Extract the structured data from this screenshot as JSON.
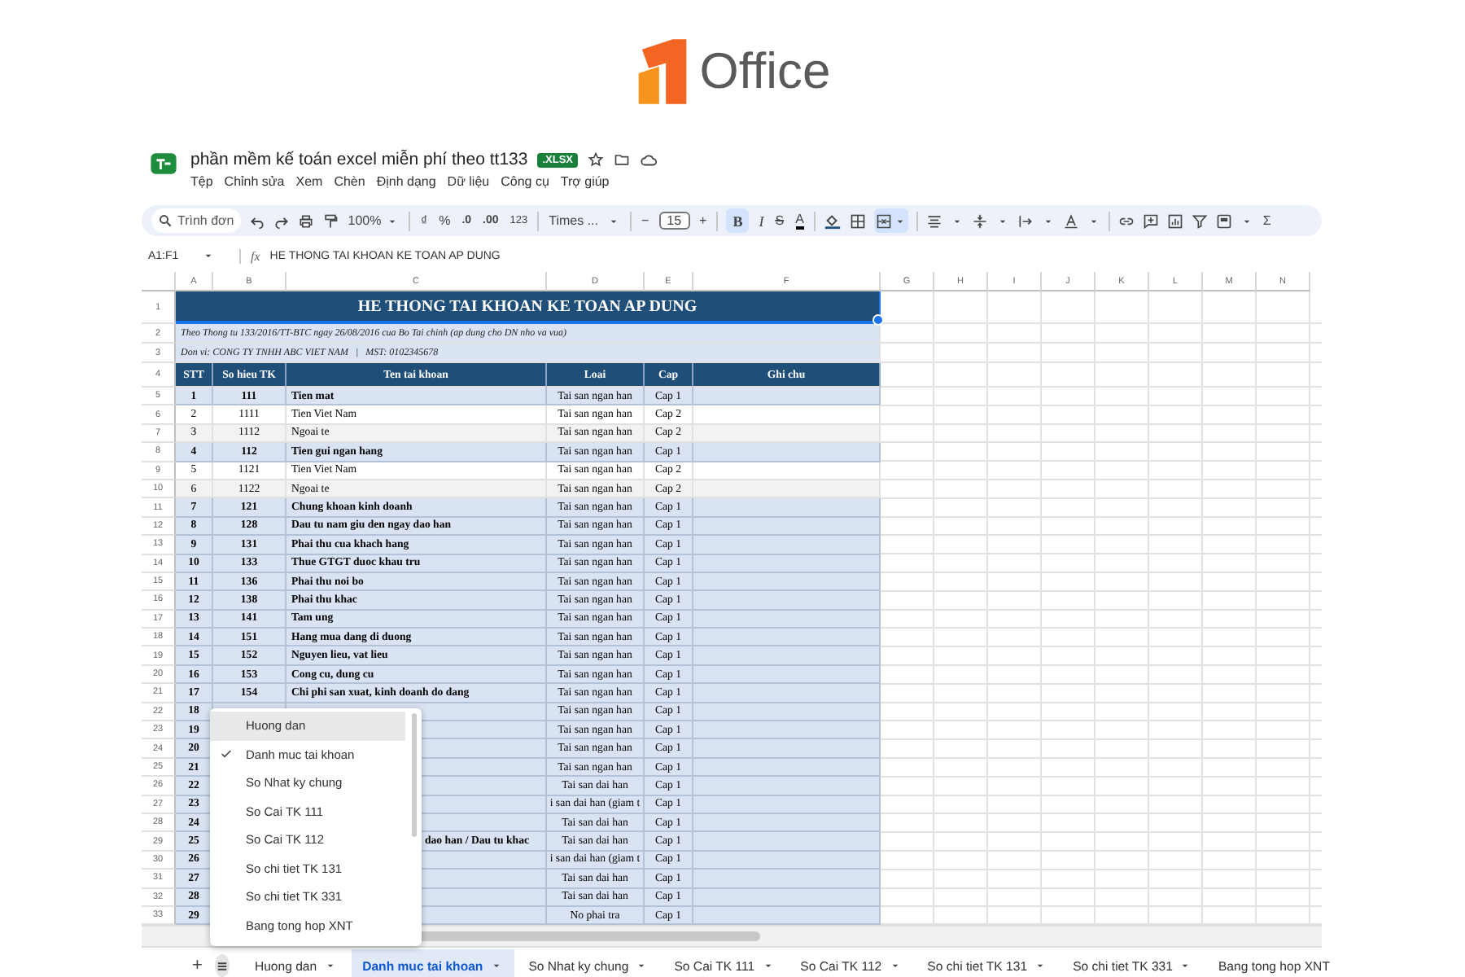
{
  "logo": {
    "text": "Office"
  },
  "document": {
    "title": "phần mềm kế toán excel miễn phí theo tt133",
    "badge": ".XLSX"
  },
  "menu": [
    "Tệp",
    "Chỉnh sửa",
    "Xem",
    "Chèn",
    "Định dạng",
    "Dữ liệu",
    "Công cụ",
    "Trợ giúp"
  ],
  "toolbar": {
    "search_placeholder": "Trình đơn",
    "zoom": "100%",
    "currency": "₫",
    "percent": "%",
    "decrease_decimal": ".0",
    "increase_decimal": ".00",
    "number_format": "123",
    "font": "Times ...",
    "minus": "−",
    "font_size": "15",
    "plus": "+",
    "bold": {
      "label": "B",
      "on": true
    },
    "italic": "I",
    "strike": "S",
    "text_color": "A",
    "sum": "Σ"
  },
  "formula_bar": {
    "range": "A1:F1",
    "fx": "fx",
    "content": "HE THONG TAI KHOAN KE TOAN AP DUNG"
  },
  "column_headers": [
    "A",
    "B",
    "C",
    "D",
    "E",
    "F",
    "G",
    "H",
    "I",
    "J",
    "K",
    "L",
    "M",
    "N"
  ],
  "row_headers": [
    "1",
    "2",
    "3",
    "4",
    "5",
    "6",
    "7",
    "8",
    "9",
    "10",
    "11",
    "12",
    "13",
    "14",
    "15",
    "16",
    "17",
    "18",
    "19",
    "20",
    "21",
    "22",
    "23",
    "24",
    "25",
    "26",
    "27",
    "28",
    "29",
    "30",
    "31",
    "32",
    "33"
  ],
  "sheet": {
    "title": "HE THONG TAI KHOAN KE TOAN AP DUNG",
    "title_selected": true,
    "subtitle": "Theo Thong tu 133/2016/TT-BTC ngay 26/08/2016 cua Bo Tai chinh (ap dung cho DN nho va vua)",
    "company": "Don vi: CONG TY TNHH ABC VIET NAM   |   MST: 0102345678",
    "columns": [
      "STT",
      "So hieu TK",
      "Ten tai khoan",
      "Loai",
      "Cap",
      "Ghi chu"
    ],
    "rows": [
      {
        "kind": "account",
        "stt": "1",
        "code": "111",
        "name": "Tien mat",
        "type": "Tai san ngan han",
        "cap": "Cap 1"
      },
      {
        "kind": "sub_account",
        "stt": "2",
        "code": "1111",
        "name": "Tien Viet Nam",
        "type": "Tai san ngan han",
        "cap": "Cap 2"
      },
      {
        "kind": "sub_account",
        "stt": "3",
        "code": "1112",
        "name": "Ngoai te",
        "type": "Tai san ngan han",
        "cap": "Cap 2"
      },
      {
        "kind": "account",
        "stt": "4",
        "code": "112",
        "name": "Tien gui ngan hang",
        "type": "Tai san ngan han",
        "cap": "Cap 1"
      },
      {
        "kind": "sub_account",
        "stt": "5",
        "code": "1121",
        "name": "Tien Viet Nam",
        "type": "Tai san ngan han",
        "cap": "Cap 2"
      },
      {
        "kind": "sub_account",
        "stt": "6",
        "code": "1122",
        "name": "Ngoai te",
        "type": "Tai san ngan han",
        "cap": "Cap 2"
      },
      {
        "kind": "account",
        "stt": "7",
        "code": "121",
        "name": "Chung khoan kinh doanh",
        "type": "Tai san ngan han",
        "cap": "Cap 1"
      },
      {
        "kind": "account",
        "stt": "8",
        "code": "128",
        "name": "Dau tu nam giu den ngay dao han",
        "type": "Tai san ngan han",
        "cap": "Cap 1"
      },
      {
        "kind": "account",
        "stt": "9",
        "code": "131",
        "name": "Phai thu cua khach hang",
        "type": "Tai san ngan han",
        "cap": "Cap 1"
      },
      {
        "kind": "account",
        "stt": "10",
        "code": "133",
        "name": "Thue GTGT duoc khau tru",
        "type": "Tai san ngan han",
        "cap": "Cap 1"
      },
      {
        "kind": "account",
        "stt": "11",
        "code": "136",
        "name": "Phai thu noi bo",
        "type": "Tai san ngan han",
        "cap": "Cap 1"
      },
      {
        "kind": "account",
        "stt": "12",
        "code": "138",
        "name": "Phai thu khac",
        "type": "Tai san ngan han",
        "cap": "Cap 1"
      },
      {
        "kind": "account",
        "stt": "13",
        "code": "141",
        "name": "Tam ung",
        "type": "Tai san ngan han",
        "cap": "Cap 1"
      },
      {
        "kind": "account",
        "stt": "14",
        "code": "151",
        "name": "Hang mua dang di duong",
        "type": "Tai san ngan han",
        "cap": "Cap 1"
      },
      {
        "kind": "account",
        "stt": "15",
        "code": "152",
        "name": "Nguyen lieu, vat lieu",
        "type": "Tai san ngan han",
        "cap": "Cap 1"
      },
      {
        "kind": "account",
        "stt": "16",
        "code": "153",
        "name": "Cong cu, dung cu",
        "type": "Tai san ngan han",
        "cap": "Cap 1"
      },
      {
        "kind": "account",
        "stt": "17",
        "code": "154",
        "name": "Chi phi san xuat, kinh doanh do dang",
        "type": "Tai san ngan han",
        "cap": "Cap 1"
      },
      {
        "kind": "account",
        "stt": "18",
        "type": "Tai san ngan han",
        "cap": "Cap 1"
      },
      {
        "kind": "account",
        "stt": "19",
        "type": "Tai san ngan han",
        "cap": "Cap 1"
      },
      {
        "kind": "account",
        "stt": "20",
        "type": "Tai san ngan han",
        "cap": "Cap 1"
      },
      {
        "kind": "account",
        "stt": "21",
        "type": "Tai san ngan han",
        "cap": "Cap 1"
      },
      {
        "kind": "account",
        "stt": "22",
        "type": "Tai san dai han",
        "cap": "Cap 1"
      },
      {
        "kind": "account",
        "stt": "23",
        "type": "i san dai han (giam t",
        "cap": "Cap 1"
      },
      {
        "kind": "account",
        "stt": "24",
        "type": "Tai san dai han",
        "cap": "Cap 1"
      },
      {
        "kind": "account",
        "stt": "25",
        "name": "dao han / Dau tu khac",
        "name_clipped": true,
        "type": "Tai san dai han",
        "cap": "Cap 1"
      },
      {
        "kind": "account",
        "stt": "26",
        "type": "i san dai han (giam t",
        "cap": "Cap 1"
      },
      {
        "kind": "account",
        "stt": "27",
        "type": "Tai san dai han",
        "cap": "Cap 1"
      },
      {
        "kind": "account",
        "stt": "28",
        "type": "Tai san dai han",
        "cap": "Cap 1"
      },
      {
        "kind": "account",
        "stt": "29",
        "type": "No phai tra",
        "cap": "Cap 1"
      }
    ]
  },
  "sheet_menu": [
    {
      "label": "Huong dan",
      "selected": false,
      "hovered": true
    },
    {
      "label": "Danh muc tai khoan",
      "selected": true,
      "hovered": false
    },
    {
      "label": "So Nhat ky chung",
      "selected": false,
      "hovered": false
    },
    {
      "label": "So Cai TK 111",
      "selected": false,
      "hovered": false
    },
    {
      "label": "So Cai TK 112",
      "selected": false,
      "hovered": false
    },
    {
      "label": "So chi tiet TK 131",
      "selected": false,
      "hovered": false
    },
    {
      "label": "So chi tiet TK 331",
      "selected": false,
      "hovered": false
    },
    {
      "label": "Bang tong hop XNT",
      "selected": false,
      "hovered": false
    }
  ],
  "add_sheet": "+",
  "sheet_tabs": [
    {
      "label": "Huong dan",
      "selected": false
    },
    {
      "label": "Danh muc tai khoan",
      "selected": true
    },
    {
      "label": "So Nhat ky chung",
      "selected": false
    },
    {
      "label": "So Cai TK 111",
      "selected": false
    },
    {
      "label": "So Cai TK 112",
      "selected": false
    },
    {
      "label": "So chi tiet TK 131",
      "selected": false
    },
    {
      "label": "So chi tiet TK 331",
      "selected": false
    },
    {
      "label": "Bang tong hop XNT",
      "selected": false
    }
  ]
}
